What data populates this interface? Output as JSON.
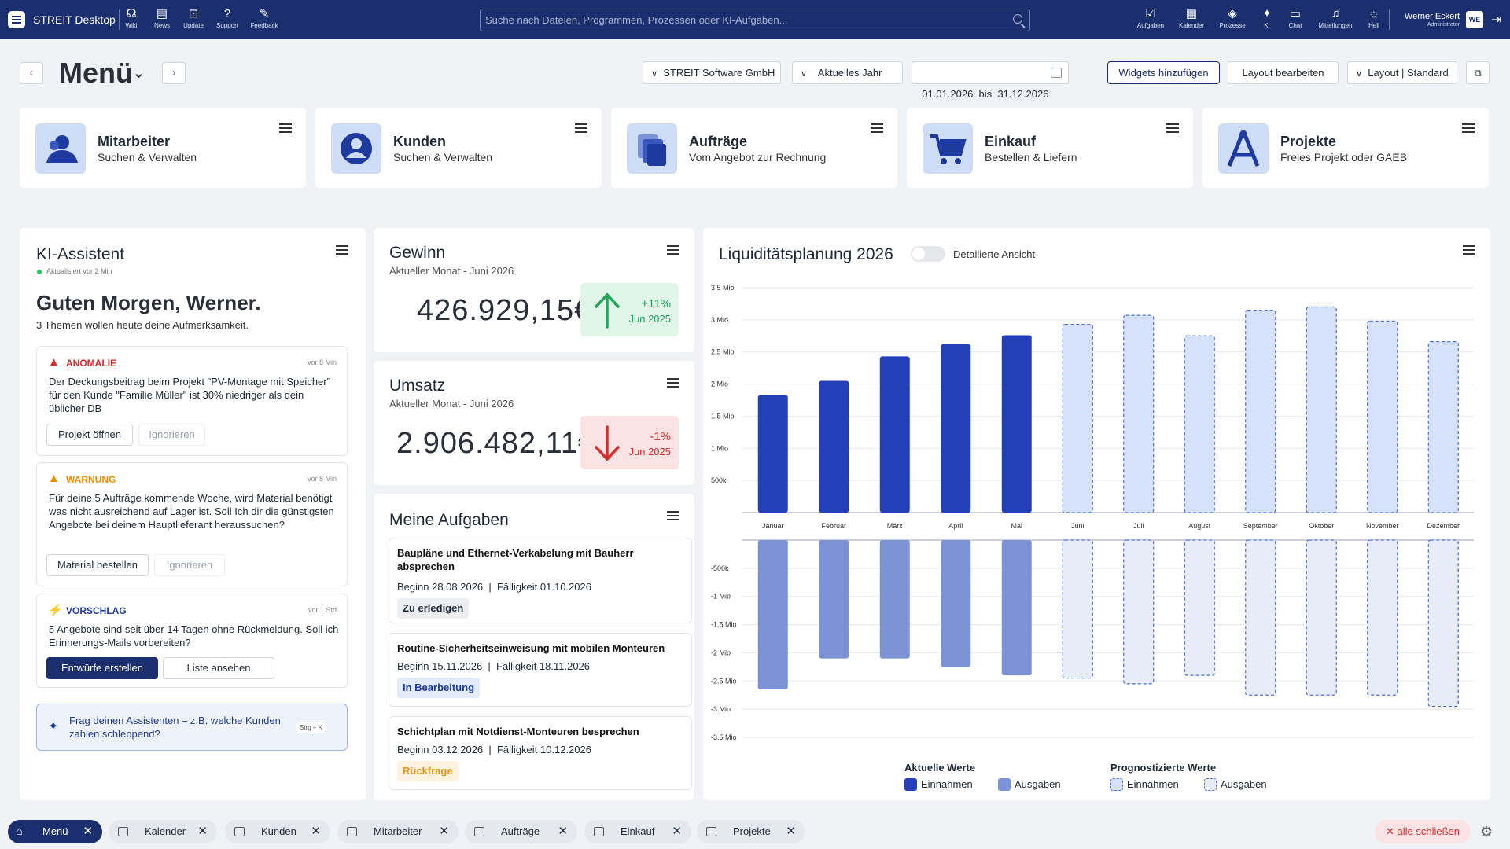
{
  "topbar": {
    "app_title": "STREIT Desktop",
    "nav": [
      {
        "label": "Wiki",
        "icon": "wiki-icon",
        "glyph": "☊"
      },
      {
        "label": "News",
        "icon": "news-icon",
        "glyph": "▤"
      },
      {
        "label": "Update",
        "icon": "update-icon",
        "glyph": "⊡"
      },
      {
        "label": "Support",
        "icon": "support-icon",
        "glyph": "?"
      },
      {
        "label": "Feedback",
        "icon": "feedback-icon",
        "glyph": "✎"
      }
    ],
    "search_placeholder": "Suche nach Dateien, Programmen, Prozessen oder KI-Aufgaben...",
    "right_nav": [
      {
        "label": "Aufgaben",
        "icon": "tasks-icon",
        "glyph": "☑"
      },
      {
        "label": "Kalender",
        "icon": "calendar-icon",
        "glyph": "▦"
      },
      {
        "label": "Prozesse",
        "icon": "processes-icon",
        "glyph": "◈"
      },
      {
        "label": "KI",
        "icon": "ai-sparkle-icon",
        "glyph": "✦"
      },
      {
        "label": "Chat",
        "icon": "chat-icon",
        "glyph": "▭"
      },
      {
        "label": "Mitteilungen",
        "icon": "bell-icon",
        "glyph": "♫"
      },
      {
        "label": "Hell",
        "icon": "sun-icon",
        "glyph": "☼"
      }
    ],
    "user_name": "Werner Eckert",
    "user_role": "Administrator",
    "avatar_initials": "WE",
    "colors": {
      "navy": "#1b2f6e"
    }
  },
  "header": {
    "title": "Menü",
    "company": "STREIT Software GmbH",
    "period": "Aktuelles Jahr",
    "date_range": "01.01.2026  bis  31.12.2026",
    "add_widgets": "Widgets hinzufügen",
    "edit_layout": "Layout bearbeiten",
    "layout_select": "Layout | Standard"
  },
  "tiles": [
    {
      "title": "Mitarbeiter",
      "subtitle": "Suchen & Verwalten",
      "icon": "employees-icon"
    },
    {
      "title": "Kunden",
      "subtitle": "Suchen & Verwalten",
      "icon": "customer-icon"
    },
    {
      "title": "Aufträge",
      "subtitle": "Vom Angebot zur Rechnung",
      "icon": "orders-icon"
    },
    {
      "title": "Einkauf",
      "subtitle": "Bestellen & Liefern",
      "icon": "cart-icon"
    },
    {
      "title": "Projekte",
      "subtitle": "Freies Projekt oder GAEB",
      "icon": "projects-icon"
    }
  ],
  "ki": {
    "title": "KI-Assistent",
    "updated": "Aktualisiert vor 2 Min",
    "greeting": "Guten Morgen, Werner.",
    "subline": "3 Themen wollen heute deine Aufmerksamkeit.",
    "alerts": [
      {
        "type": "ANOMALIE",
        "time": "vor 8 Min",
        "color": "#d32f2f",
        "text": "Der Deckungsbeitrag beim Projekt \"PV-Montage mit Speicher\" für den Kunde \"Familie Müller\" ist 30% niedriger als dein üblicher DB",
        "primary": "Projekt öffnen",
        "secondary": "Ignorieren"
      },
      {
        "type": "WARNUNG",
        "time": "vor 8 Min",
        "color": "#f08c00",
        "text": "Für deine 5 Aufträge kommende Woche, wird Material benötigt was nicht ausreichend auf Lager ist. Soll Ich dir die günstigsten Angebote bei deinem Hauptlieferant heraussuchen?",
        "primary": "Material bestellen",
        "secondary": "Ignorieren"
      },
      {
        "type": "VORSCHLAG",
        "time": "vor 1 Std",
        "color": "#1e3a9e",
        "text": "5 Angebote sind seit über 14 Tagen ohne Rückmeldung. Soll ich Erinnerungs-Mails vorbereiten?",
        "primary": "Entwürfe erstellen",
        "secondary": "Liste ansehen"
      }
    ],
    "ask_text": "Frag deinen Assistenten – z.B. welche Kunden zahlen schleppend?",
    "ask_shortcut": "Strg + K"
  },
  "gewinn": {
    "title": "Gewinn",
    "subtitle": "Aktueller Monat - Juni 2026",
    "value": "426.929,15€",
    "change": "+11%",
    "ref": "Jun 2025",
    "color": "#22a55a"
  },
  "umsatz": {
    "title": "Umsatz",
    "subtitle": "Aktueller Monat - Juni 2026",
    "value": "2.906.482,11€",
    "change": "-1%",
    "ref": "Jun 2025",
    "color": "#d32f2f"
  },
  "tasks": {
    "title": "Meine Aufgaben",
    "items": [
      {
        "title": "Baupläne und Ethernet-Verkabelung mit Bauherr absprechen",
        "dates": "Beginn 28.08.2026  |  Fälligkeit 01.10.2026",
        "status": "Zu erledigen",
        "bg": "#eceef1",
        "fg": "#1f2937"
      },
      {
        "title": "Routine-Sicherheitseinweisung mit mobilen Monteuren",
        "dates": "Beginn 15.11.2026  |  Fälligkeit 18.11.2026",
        "status": "In Bearbeitung",
        "bg": "#e3ebfb",
        "fg": "#1e3a9e"
      },
      {
        "title": "Schichtplan mit Notdienst-Monteuren besprechen",
        "dates": "Beginn 03.12.2026  |  Fälligkeit 10.12.2026",
        "status": "Rückfrage",
        "bg": "#fdf3df",
        "fg": "#e59a1c"
      }
    ]
  },
  "liquidity": {
    "title": "Liquiditätsplanung 2026",
    "toggle_label": "Detailierte Ansicht",
    "legend": {
      "current_title": "Aktuelle Werte",
      "forecast_title": "Prognostizierte Werte",
      "income": "Einnahmen",
      "expense": "Ausgaben"
    }
  },
  "chart_data": {
    "type": "bar",
    "categories": [
      "Januar",
      "Februar",
      "März",
      "April",
      "Mai",
      "Juni",
      "Juli",
      "August",
      "September",
      "Oktober",
      "November",
      "Dezember"
    ],
    "series": [
      {
        "name": "Einnahmen",
        "kind": "current",
        "values": [
          1.83,
          2.05,
          2.43,
          2.62,
          2.76,
          null,
          null,
          null,
          null,
          null,
          null,
          null
        ]
      },
      {
        "name": "Ausgaben",
        "kind": "current",
        "values": [
          -2.65,
          -2.1,
          -2.1,
          -2.25,
          -2.4,
          null,
          null,
          null,
          null,
          null,
          null,
          null
        ]
      },
      {
        "name": "Einnahmen",
        "kind": "forecast",
        "values": [
          null,
          null,
          null,
          null,
          null,
          2.93,
          3.07,
          2.75,
          3.15,
          3.2,
          2.98,
          2.66
        ]
      },
      {
        "name": "Ausgaben",
        "kind": "forecast",
        "values": [
          null,
          null,
          null,
          null,
          null,
          -2.45,
          -2.55,
          -2.4,
          -2.75,
          -2.75,
          -2.75,
          -2.95
        ]
      }
    ],
    "yticks": [
      "3.5 Mio",
      "3 Mio",
      "2.5 Mio",
      "2 Mio",
      "1.5 Mio",
      "1 Mio",
      "500k",
      "-500k",
      "-1 Mio",
      "-1.5 Mio",
      "-2 Mio",
      "-2.5 Mio",
      "-3 Mio",
      "-3.5 Mio"
    ],
    "ylim_pos": [
      0,
      3.5
    ],
    "ylim_neg": [
      -3.5,
      0
    ],
    "unit": "Mio",
    "grid": true,
    "colors": {
      "income": "#2340b8",
      "expense": "#7b93d6",
      "forecast_income": "#d6e2fb",
      "forecast_expense": "#e8ecf7",
      "forecast_border": "#4d6fd6"
    }
  },
  "bottom_tabs": [
    {
      "label": "Menü",
      "active": true,
      "icon": "home-icon"
    },
    {
      "label": "Kalender",
      "active": false,
      "icon": "calendar-icon"
    },
    {
      "label": "Kunden",
      "active": false,
      "icon": "calendar-icon"
    },
    {
      "label": "Mitarbeiter",
      "active": false,
      "icon": "calendar-icon"
    },
    {
      "label": "Aufträge",
      "active": false,
      "icon": "calendar-icon"
    },
    {
      "label": "Einkauf",
      "active": false,
      "icon": "calendar-icon"
    },
    {
      "label": "Projekte",
      "active": false,
      "icon": "calendar-icon"
    }
  ],
  "close_all": "alle schließen"
}
